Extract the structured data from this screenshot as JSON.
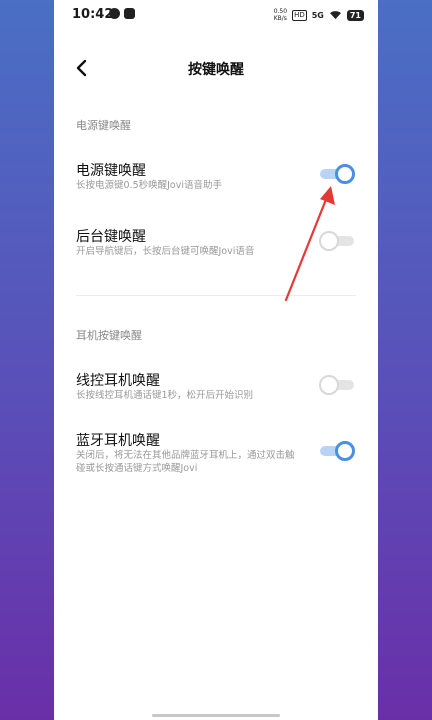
{
  "status_bar": {
    "time": "10:42",
    "left_icons": [
      "notification-icon",
      "app-icon"
    ],
    "net_speed_top": "0.50",
    "net_speed_bottom": "KB/s",
    "hd_label": "HD",
    "signal_label": "5G",
    "battery": "71"
  },
  "header": {
    "title": "按键唤醒",
    "back_icon": "back-chevron-icon"
  },
  "sections": {
    "power": {
      "title": "电源键唤醒",
      "items": [
        {
          "title": "电源键唤醒",
          "desc": "长按电源键0.5秒唤醒Jovi语音助手",
          "enabled": true
        },
        {
          "title": "后台键唤醒",
          "desc": "开启导航键后，长按后台键可唤醒Jovi语音",
          "enabled": false
        }
      ]
    },
    "earphone": {
      "title": "耳机按键唤醒",
      "items": [
        {
          "title": "线控耳机唤醒",
          "desc": "长按线控耳机通话键1秒，松开后开始识别",
          "enabled": false
        },
        {
          "title": "蓝牙耳机唤醒",
          "desc": "关闭后，将无法在其他品牌蓝牙耳机上，通过双击触碰或长按通话键方式唤醒Jovi",
          "enabled": true
        }
      ]
    }
  },
  "colors": {
    "toggle_on": "#4a8fe0",
    "toggle_on_track": "#b9d3f5",
    "toggle_off": "#d8d8d8",
    "annotation_arrow": "#e53935",
    "background_top": "#4a6fc4",
    "background_bottom": "#6a2fa8"
  }
}
